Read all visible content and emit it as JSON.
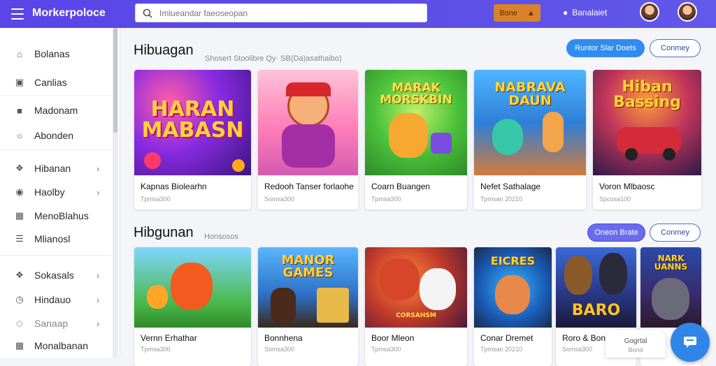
{
  "app": {
    "brand": "Morkerpoloce"
  },
  "search": {
    "placeholder": "Imlueandar faeoseopan",
    "value": ""
  },
  "topbar": {
    "action_label": "Bone",
    "user_label": "Banalaiet"
  },
  "sidebar": {
    "items": [
      {
        "label": "Bolanas",
        "icon": "home-icon",
        "chev": false
      },
      {
        "label": "Canlias",
        "icon": "box-icon",
        "chev": false
      },
      {
        "label": "Madonam",
        "icon": "bag-icon",
        "chev": false
      },
      {
        "label": "Abonden",
        "icon": "circle-icon",
        "chev": false
      },
      {
        "label": "Hibanan",
        "icon": "puzzle-icon",
        "chev": true
      },
      {
        "label": "Haolby",
        "icon": "camera-icon",
        "chev": true
      },
      {
        "label": "MenoBlahus",
        "icon": "grid-icon",
        "chev": false
      },
      {
        "label": "Mlianosl",
        "icon": "list-icon",
        "chev": false
      },
      {
        "label": "Sokasals",
        "icon": "puzzle-icon",
        "chev": true
      },
      {
        "label": "Hindauo",
        "icon": "clock-icon",
        "chev": true
      },
      {
        "label": "Sanaap",
        "icon": "tag-icon",
        "chev": true
      },
      {
        "label": "Monalbanan",
        "icon": "grid-icon",
        "chev": false
      }
    ]
  },
  "section1": {
    "title": "Hibuagan",
    "subtitle": "Shosert Stoolibre Qy· SB(Da)asathaibo)",
    "primary_label": "Runtor Slar Doets",
    "outline_label": "Conmey",
    "cards": [
      {
        "title": "Kapnas Biolearhn",
        "meta": "Tpmsa300",
        "art_text": "HARAN MABASN"
      },
      {
        "title": "Redooh Tanser forlaohe",
        "meta": "Somsa300",
        "art_text": ""
      },
      {
        "title": "Coarn Buangen",
        "meta": "Tpmsa300",
        "art_text": "MARAK MORSKBIN"
      },
      {
        "title": "Nefet Sathalage",
        "meta": "Tpmsan 20210",
        "art_text": "NABRAVA DAUN"
      },
      {
        "title": "Voron Mlbaosc",
        "meta": "Spcosa100",
        "art_text": "Hiban Bassing"
      }
    ]
  },
  "section2": {
    "title": "Hibgunan",
    "subtitle": "Honsosos",
    "primary_label": "Oneon Brate",
    "outline_label": "Conmey",
    "cards": [
      {
        "title": "Vernn Erhathar",
        "meta": "Tpmsa300",
        "art_text": ""
      },
      {
        "title": "Bonnhena",
        "meta": "Somsa300",
        "art_text": "MANOR GAMES"
      },
      {
        "title": "Boor Mleon",
        "meta": "Tpmsa300",
        "art_text": "CORSAHSM"
      },
      {
        "title": "Conar Dremet",
        "meta": "Tpmsan 20210",
        "art_text": "EICRES"
      },
      {
        "title": "Roro & Bone",
        "meta": "Somsa300",
        "art_text": "BARO"
      },
      {
        "title": "",
        "meta": "",
        "art_text": "NARK UANNS"
      }
    ]
  },
  "floating": {
    "card_label": "Gogrtal",
    "card_sub": "Bond"
  },
  "colors": {
    "topbar": "#5a45e8",
    "accent": "#2f8cf0",
    "violet": "#6a6cf0",
    "action": "#d9822b"
  }
}
